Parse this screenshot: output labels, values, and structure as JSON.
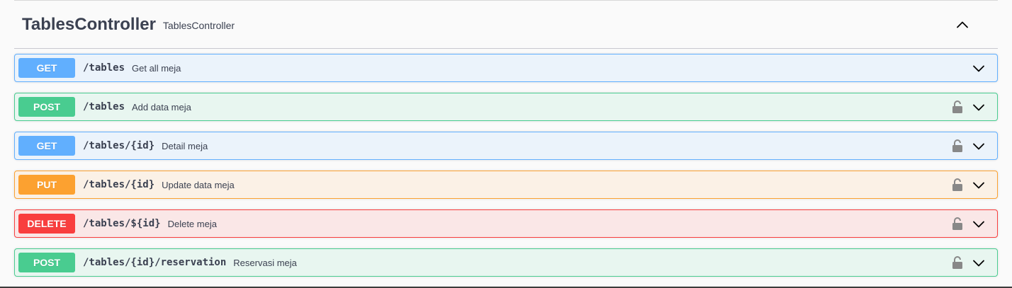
{
  "tag": {
    "name": "TablesController",
    "description": "TablesController",
    "collapse_icon": "chevron-up-icon"
  },
  "operations": [
    {
      "method": "GET",
      "path": "/tables",
      "summary": "Get all meja",
      "locked": false
    },
    {
      "method": "POST",
      "path": "/tables",
      "summary": "Add data meja",
      "locked": true
    },
    {
      "method": "GET",
      "path": "/tables/{id}",
      "summary": "Detail meja",
      "locked": true
    },
    {
      "method": "PUT",
      "path": "/tables/{id}",
      "summary": "Update data meja",
      "locked": true
    },
    {
      "method": "DELETE",
      "path": "/tables/${id}",
      "summary": "Delete meja",
      "locked": true
    },
    {
      "method": "POST",
      "path": "/tables/{id}/reservation",
      "summary": "Reservasi meja",
      "locked": true
    }
  ],
  "colors": {
    "get": "#61affe",
    "post": "#49cc90",
    "put": "#fca130",
    "delete": "#f93e3e",
    "text": "#3b4151"
  }
}
